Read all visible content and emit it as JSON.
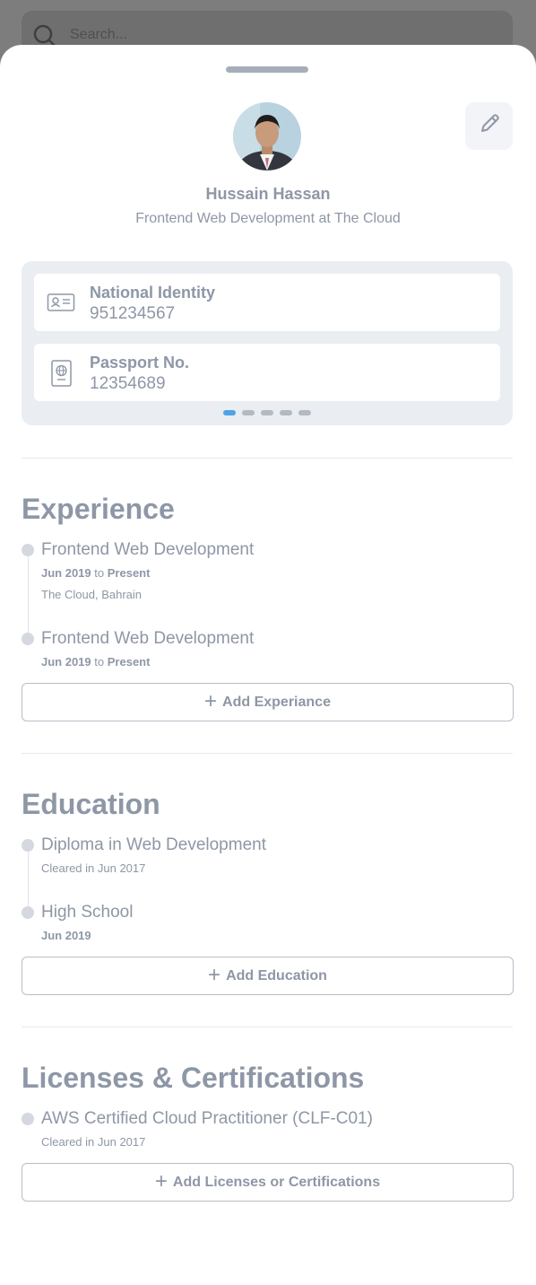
{
  "search": {
    "placeholder": "Search..."
  },
  "profile": {
    "name": "Hussain Hassan",
    "headline": "Frontend Web Development at The Cloud"
  },
  "ids": [
    {
      "label": "National Identity",
      "value": "951234567",
      "icon": "id-card-icon"
    },
    {
      "label": "Passport No.",
      "value": "12354689",
      "icon": "passport-icon"
    }
  ],
  "carousel": {
    "count": 5,
    "active": 1
  },
  "experience": {
    "title": "Experience",
    "items": [
      {
        "title": "Frontend Web Development",
        "start": "Jun 2019",
        "to": "to",
        "end": "Present",
        "location": "The Cloud, Bahrain"
      },
      {
        "title": "Frontend Web Development",
        "start": "Jun 2019",
        "to": "to",
        "end": "Present"
      }
    ],
    "add_label": "Add Experiance"
  },
  "education": {
    "title": "Education",
    "items": [
      {
        "title": "Diploma in Web Development",
        "sub": "Cleared in Jun 2017"
      },
      {
        "title": "High School",
        "sub": "Jun 2019"
      }
    ],
    "add_label": "Add Education"
  },
  "licenses": {
    "title": "Licenses & Certifications",
    "items": [
      {
        "title": "AWS Certified Cloud Practitioner (CLF-C01)",
        "sub": "Cleared in Jun 2017"
      }
    ],
    "add_label": "Add Licenses or Certifications"
  },
  "colors": {
    "text": "#8e97a6",
    "accent": "#4ea3e4",
    "panel": "#eaedf1"
  }
}
